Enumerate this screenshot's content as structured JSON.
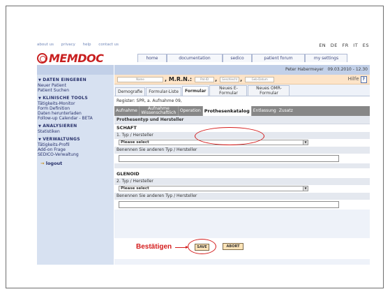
{
  "top_links": [
    "about us",
    "privacy",
    "help",
    "contact us"
  ],
  "languages": [
    "EN",
    "DE",
    "FR",
    "IT",
    "ES"
  ],
  "logo_text": "MEMDOC",
  "top_nav": [
    "home",
    "documentation",
    "sedico",
    "patient forum",
    "my settings"
  ],
  "user": {
    "name": "Peter Habermeyer",
    "datetime": "09.03.2010 - 12.30"
  },
  "sidebar": {
    "sections": [
      {
        "title": "DATEN EINGEBEN",
        "items": [
          "Neuer Patient",
          "Patient Suchen"
        ]
      },
      {
        "title": "KLINISCHE TOOLS",
        "items": [
          "Tätigkeits-Monitor",
          "Form Definition",
          "Daten herunterladen",
          "Follow-up Calendar - BETA"
        ]
      },
      {
        "title": "ANALYSIEREN",
        "items": [
          "Statistiken"
        ]
      },
      {
        "title": "VERWALTUNGS",
        "items": [
          "Tätigkeits-Profil",
          "Add-on Frage",
          "SEDICO-Verwaltung"
        ]
      }
    ],
    "logout": "logout"
  },
  "patient_bar": {
    "name_box": "Name",
    "mrn_label": ", M.R.N.:",
    "patid_box": "Pat-ID",
    "sex_box": "Geschlecht",
    "dob_box": "Geb-Datum",
    "help": "Hilfe",
    "help_icon": "?"
  },
  "sub_tabs": [
    "Demografie",
    "Formular-Liste",
    "Formular",
    "Neues E-Formular",
    "Neues OMR-Formular"
  ],
  "register": "Register: SPR, a. Aufnahme 09,",
  "section_tabs": [
    "Aufnahme",
    "Aufnahme Wissenschaftlich",
    "Operation",
    "Prothesenkatalog",
    "Entlassung",
    "Zusatz"
  ],
  "form": {
    "title": "Prothesentyp und Hersteller",
    "groups": [
      {
        "name": "SCHAFT",
        "type_label": "1. Typ / Hersteller",
        "select_value": "Please select",
        "other_label": "Benennen Sie anderen Typ / Hersteller"
      },
      {
        "name": "GLENOID",
        "type_label": "2. Typ / Hersteller",
        "select_value": "Please select",
        "other_label": "Benennen Sie anderen Typ / Hersteller"
      }
    ]
  },
  "actions": {
    "confirm_text": "Bestätigen",
    "save": "SAVE",
    "abort": "ABORT"
  },
  "colors": {
    "brand_red": "#c81f1f",
    "sidebar_bg": "#d7e1f1",
    "patient_bar_bg": "#fde4c8",
    "section_tabs_bg": "#878787",
    "annotation_red": "#d41c1c"
  }
}
